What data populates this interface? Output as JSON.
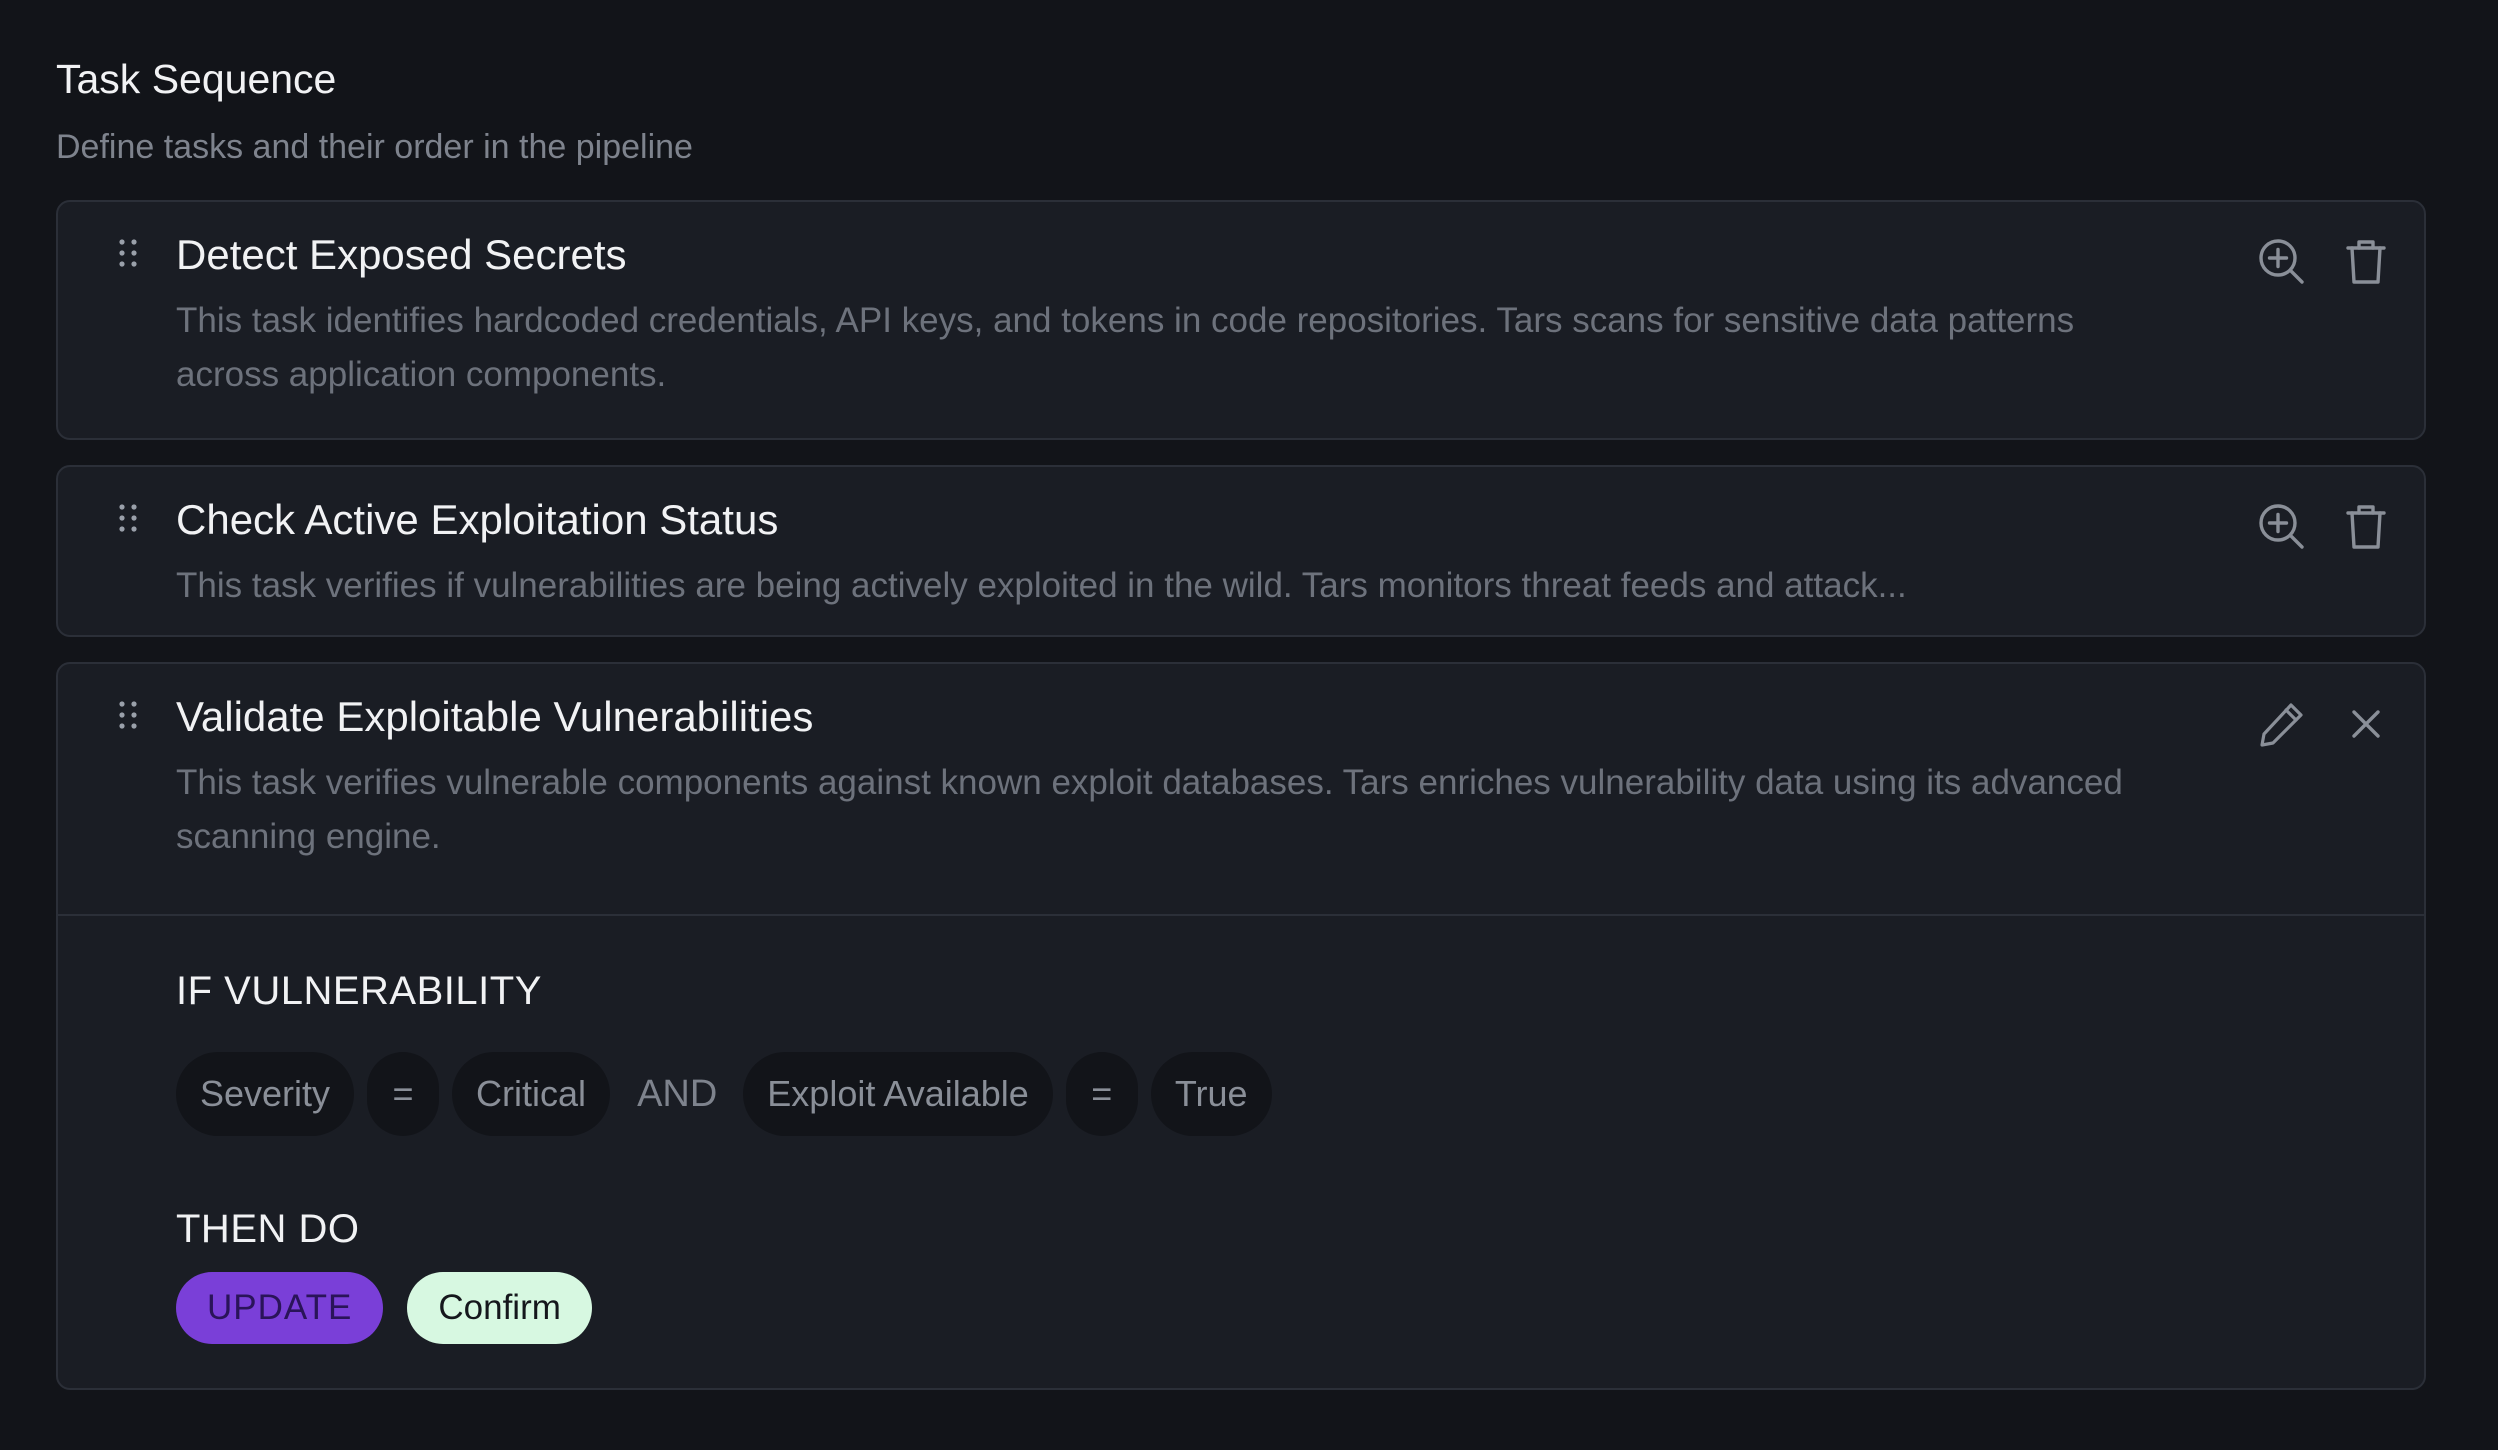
{
  "header": {
    "title": "Task Sequence",
    "subtitle": "Define tasks and their order in the pipeline"
  },
  "tasks": [
    {
      "title": "Detect Exposed Secrets",
      "description": "This task identifies hardcoded credentials, API keys, and tokens in code repositories. Tars scans for sensitive data patterns across application components.",
      "actions": [
        "zoom-in-icon",
        "trash-icon"
      ]
    },
    {
      "title": "Check Active Exploitation Status",
      "description": "This task verifies if vulnerabilities are being actively exploited in the wild. Tars monitors threat feeds and attack...",
      "actions": [
        "zoom-in-icon",
        "trash-icon"
      ]
    },
    {
      "title": "Validate Exploitable Vulnerabilities",
      "description": "This task verifies vulnerable components against known exploit databases. Tars enriches vulnerability data using its advanced scanning engine.",
      "actions": [
        "pencil-icon",
        "close-icon"
      ],
      "rule": {
        "if_label": "IF VULNERABILITY",
        "conditions": [
          {
            "field": "Severity",
            "operator": "=",
            "value": "Critical"
          },
          {
            "field": "Exploit Available",
            "operator": "=",
            "value": "True"
          }
        ],
        "joiner": "AND",
        "then_label": "THEN DO",
        "action_button": "UPDATE",
        "confirm_button": "Confirm"
      }
    }
  ],
  "colors": {
    "background": "#121419",
    "card": "#1a1d24",
    "border": "#2b2f38",
    "update_button": "#7a3fd8",
    "confirm_button": "#d7f8e1"
  }
}
